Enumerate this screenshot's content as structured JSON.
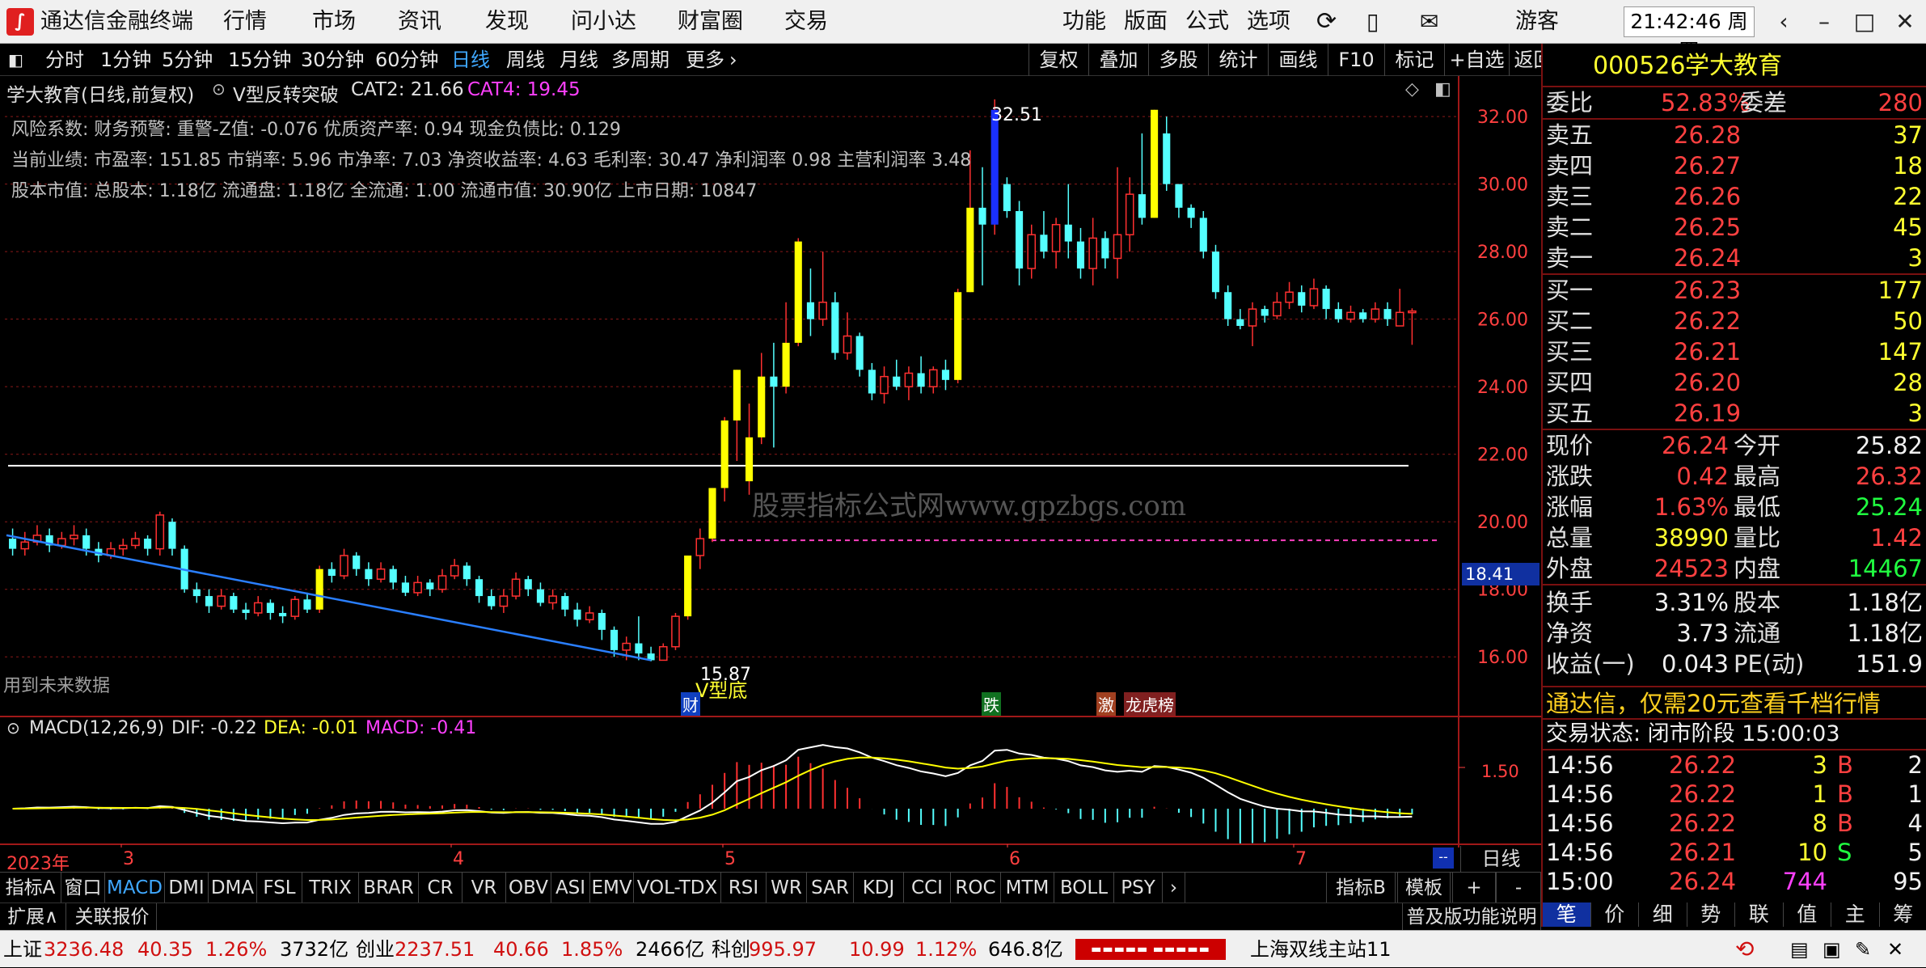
{
  "window": {
    "app_title": "通达信金融终端",
    "menus": [
      "行情",
      "市场",
      "资讯",
      "发现",
      "问小达",
      "财富圈",
      "交易"
    ],
    "tools": [
      "功能",
      "版面",
      "公式",
      "选项"
    ],
    "user": "游客",
    "clock": "21:42:46 周四"
  },
  "periods": [
    "分时",
    "1分钟",
    "5分钟",
    "15分钟",
    "30分钟",
    "60分钟",
    "日线",
    "周线",
    "月线",
    "多周期",
    "更多"
  ],
  "active_period": "日线",
  "right_buttons": [
    "复权",
    "叠加",
    "多股",
    "统计",
    "画线",
    "F10",
    "标记",
    "+自选",
    "返回"
  ],
  "chart_header": {
    "name": "学大教育(日线,前复权)",
    "indicator": "V型反转突破",
    "cat2": "CAT2: 21.66",
    "cat4": "CAT4: 19.45"
  },
  "info_lines": [
    "风险系数: 财务预警: 重警-Z值: -0.076 优质资产率: 0.94 现金负债比: 0.129",
    "当前业绩: 市盈率: 151.85 市销率: 5.96 市净率: 7.03 净资收益率: 4.63 毛利率: 30.47 净利润率 0.98 主营利润率 3.48",
    "股本市值: 总股本: 1.18亿 流通盘: 1.18亿 全流通: 1.00 流通市值: 30.90亿 上市日期: 10847"
  ],
  "annotations": {
    "future_data": "用到未来数据",
    "high_label": "32.51",
    "low_label": "15.87",
    "v_bottom": "V型底",
    "watermark": "股票指标公式网www.gpzbgs.com",
    "marks": [
      "财",
      "跌",
      "激",
      "龙虎榜"
    ],
    "price_tag": "18.41"
  },
  "macd_header": {
    "name": "MACD(12,26,9)",
    "dif": "DIF: -0.22",
    "dea": "DEA: -0.01",
    "macd": "MACD: -0.41",
    "axis_label": "1.50"
  },
  "x_axis": {
    "year": "2023年",
    "months": [
      "3",
      "4",
      "5",
      "6",
      "7"
    ],
    "period": "日线"
  },
  "colors": {
    "up": "#ff3030",
    "down": "#54ffff",
    "macd_dif": "#ffffff",
    "macd_dea": "#ffff00",
    "trend": "#2a7fff"
  },
  "chart_data": {
    "type": "candlestick",
    "y_axis": {
      "ticks": [
        16.0,
        18.0,
        20.0,
        22.0,
        24.0,
        26.0,
        28.0,
        30.0,
        32.0
      ],
      "ylim": [
        15.0,
        33.2
      ]
    },
    "hline": 21.66,
    "dash_line": 19.45,
    "trendline": [
      [
        19.6,
        15.9
      ]
    ],
    "candles": [
      [
        19.5,
        19.2,
        19.8,
        19.0
      ],
      [
        19.2,
        19.4,
        19.7,
        19.0
      ],
      [
        19.4,
        19.6,
        19.9,
        19.3
      ],
      [
        19.6,
        19.3,
        19.8,
        19.1
      ],
      [
        19.3,
        19.5,
        19.7,
        19.2
      ],
      [
        19.5,
        19.6,
        19.9,
        19.3
      ],
      [
        19.6,
        19.2,
        19.8,
        19.0
      ],
      [
        19.2,
        19.0,
        19.4,
        18.8
      ],
      [
        19.0,
        19.2,
        19.4,
        18.9
      ],
      [
        19.2,
        19.3,
        19.5,
        19.0
      ],
      [
        19.3,
        19.5,
        19.7,
        19.2
      ],
      [
        19.5,
        19.2,
        19.6,
        19.0
      ],
      [
        19.2,
        20.2,
        20.3,
        19.0
      ],
      [
        20.0,
        19.2,
        20.1,
        19.0
      ],
      [
        19.2,
        18.0,
        19.3,
        17.9
      ],
      [
        18.0,
        17.8,
        18.2,
        17.6
      ],
      [
        17.8,
        17.5,
        18.0,
        17.3
      ],
      [
        17.5,
        17.8,
        18.0,
        17.4
      ],
      [
        17.8,
        17.4,
        17.9,
        17.3
      ],
      [
        17.4,
        17.3,
        17.6,
        17.1
      ],
      [
        17.3,
        17.6,
        17.8,
        17.2
      ],
      [
        17.6,
        17.3,
        17.7,
        17.1
      ],
      [
        17.3,
        17.2,
        17.5,
        17.0
      ],
      [
        17.2,
        17.7,
        17.8,
        17.1
      ],
      [
        17.7,
        17.4,
        17.9,
        17.3
      ],
      [
        17.4,
        18.6,
        18.7,
        17.3
      ],
      [
        18.6,
        18.4,
        18.8,
        18.2
      ],
      [
        18.4,
        19.0,
        19.2,
        18.3
      ],
      [
        19.0,
        18.6,
        19.1,
        18.4
      ],
      [
        18.6,
        18.3,
        18.8,
        18.1
      ],
      [
        18.3,
        18.6,
        18.8,
        18.2
      ],
      [
        18.6,
        18.2,
        18.7,
        18.0
      ],
      [
        18.2,
        17.9,
        18.4,
        17.8
      ],
      [
        17.9,
        18.2,
        18.4,
        17.8
      ],
      [
        18.2,
        18.0,
        18.3,
        17.8
      ],
      [
        18.0,
        18.4,
        18.6,
        17.9
      ],
      [
        18.4,
        18.7,
        18.9,
        18.3
      ],
      [
        18.7,
        18.3,
        18.8,
        18.1
      ],
      [
        18.3,
        17.8,
        18.4,
        17.6
      ],
      [
        17.8,
        17.5,
        18.0,
        17.4
      ],
      [
        17.5,
        17.8,
        18.0,
        17.3
      ],
      [
        17.8,
        18.3,
        18.5,
        17.7
      ],
      [
        18.3,
        18.0,
        18.4,
        17.8
      ],
      [
        18.0,
        17.6,
        18.2,
        17.5
      ],
      [
        17.6,
        17.8,
        18.0,
        17.4
      ],
      [
        17.8,
        17.4,
        17.9,
        17.2
      ],
      [
        17.4,
        17.1,
        17.6,
        16.9
      ],
      [
        17.1,
        17.3,
        17.5,
        17.0
      ],
      [
        17.3,
        16.8,
        17.4,
        16.5
      ],
      [
        16.8,
        16.2,
        16.9,
        16.0
      ],
      [
        16.2,
        16.4,
        16.6,
        15.9
      ],
      [
        16.4,
        16.1,
        17.2,
        15.9
      ],
      [
        16.1,
        15.9,
        16.3,
        15.87
      ],
      [
        15.9,
        16.3,
        16.4,
        15.9
      ],
      [
        16.3,
        17.2,
        17.3,
        16.2
      ],
      [
        17.2,
        19.0,
        19.0,
        17.1
      ],
      [
        19.0,
        19.5,
        19.8,
        18.6
      ],
      [
        19.5,
        21.0,
        21.0,
        19.4
      ],
      [
        21.0,
        23.0,
        23.1,
        20.6
      ],
      [
        23.0,
        24.5,
        24.5,
        21.8
      ],
      [
        21.2,
        22.5,
        23.5,
        20.8
      ],
      [
        22.5,
        24.3,
        25.0,
        22.3
      ],
      [
        24.3,
        24.0,
        25.3,
        22.2
      ],
      [
        24.0,
        25.3,
        26.5,
        23.8
      ],
      [
        25.3,
        28.3,
        28.4,
        25.2
      ],
      [
        26.5,
        26.0,
        27.5,
        25.5
      ],
      [
        26.0,
        26.5,
        28.0,
        25.8
      ],
      [
        26.5,
        25.0,
        26.8,
        24.8
      ],
      [
        25.0,
        25.5,
        26.2,
        24.8
      ],
      [
        25.5,
        24.5,
        25.6,
        24.3
      ],
      [
        24.5,
        23.8,
        24.7,
        23.6
      ],
      [
        23.8,
        24.3,
        24.6,
        23.5
      ],
      [
        24.3,
        24.0,
        24.8,
        23.9
      ],
      [
        24.0,
        24.4,
        24.6,
        23.6
      ],
      [
        24.4,
        24.0,
        24.9,
        23.8
      ],
      [
        24.0,
        24.5,
        24.6,
        23.8
      ],
      [
        24.5,
        24.2,
        24.8,
        23.9
      ],
      [
        24.2,
        26.8,
        26.9,
        24.1
      ],
      [
        26.8,
        29.3,
        31.0,
        26.8
      ],
      [
        29.3,
        28.8,
        30.5,
        27.0
      ],
      [
        28.8,
        32.2,
        32.51,
        28.5
      ],
      [
        30.0,
        29.2,
        30.2,
        29.0
      ],
      [
        29.2,
        27.5,
        29.5,
        27.0
      ],
      [
        27.5,
        28.5,
        28.8,
        27.2
      ],
      [
        28.5,
        28.0,
        29.2,
        27.8
      ],
      [
        28.0,
        28.8,
        29.0,
        27.5
      ],
      [
        28.8,
        28.3,
        30.0,
        27.8
      ],
      [
        28.3,
        27.5,
        28.7,
        27.2
      ],
      [
        27.5,
        28.4,
        29.0,
        27.0
      ],
      [
        28.4,
        27.8,
        28.6,
        27.5
      ],
      [
        27.8,
        28.5,
        30.5,
        27.2
      ],
      [
        28.5,
        29.7,
        30.2,
        28.0
      ],
      [
        29.7,
        29.0,
        31.5,
        28.8
      ],
      [
        29.0,
        32.2,
        32.2,
        29.0
      ],
      [
        31.5,
        30.0,
        32.0,
        29.8
      ],
      [
        30.0,
        29.3,
        29.6,
        29.0
      ],
      [
        29.3,
        29.0,
        29.4,
        28.7
      ],
      [
        29.0,
        28.0,
        29.2,
        27.8
      ],
      [
        28.0,
        26.8,
        28.2,
        26.6
      ],
      [
        26.8,
        26.0,
        27.0,
        25.8
      ],
      [
        26.0,
        25.8,
        26.3,
        25.7
      ],
      [
        25.8,
        26.3,
        26.5,
        25.2
      ],
      [
        26.3,
        26.1,
        26.4,
        25.9
      ],
      [
        26.1,
        26.5,
        26.8,
        26.0
      ],
      [
        26.5,
        26.8,
        27.1,
        26.3
      ],
      [
        26.8,
        26.4,
        27.0,
        26.2
      ],
      [
        26.4,
        26.9,
        27.2,
        26.3
      ],
      [
        26.9,
        26.3,
        27.0,
        26.0
      ],
      [
        26.3,
        26.0,
        26.5,
        25.9
      ],
      [
        26.0,
        26.2,
        26.4,
        25.9
      ],
      [
        26.2,
        26.0,
        26.3,
        25.9
      ],
      [
        26.0,
        26.3,
        26.5,
        25.9
      ],
      [
        26.3,
        26.0,
        26.5,
        25.8
      ],
      [
        25.8,
        26.2,
        26.9,
        25.8
      ],
      [
        26.2,
        26.24,
        26.32,
        25.24
      ]
    ]
  },
  "right_panel": {
    "stock_code": "000526",
    "stock_name": "学大教育",
    "webi_label": "委比",
    "webi": "52.83%",
    "weicha_label": "委差",
    "weicha": "280",
    "asks": [
      {
        "label": "卖五",
        "price": "26.28",
        "vol": "37"
      },
      {
        "label": "卖四",
        "price": "26.27",
        "vol": "18"
      },
      {
        "label": "卖三",
        "price": "26.26",
        "vol": "22"
      },
      {
        "label": "卖二",
        "price": "26.25",
        "vol": "45"
      },
      {
        "label": "卖一",
        "price": "26.24",
        "vol": "3"
      }
    ],
    "bids": [
      {
        "label": "买一",
        "price": "26.23",
        "vol": "177"
      },
      {
        "label": "买二",
        "price": "26.22",
        "vol": "50"
      },
      {
        "label": "买三",
        "price": "26.21",
        "vol": "147"
      },
      {
        "label": "买四",
        "price": "26.20",
        "vol": "28"
      },
      {
        "label": "买五",
        "price": "26.19",
        "vol": "3"
      }
    ],
    "quote": [
      {
        "l1": "现价",
        "v1": "26.24",
        "c1": "red",
        "l2": "今开",
        "v2": "25.82",
        "c2": "white"
      },
      {
        "l1": "涨跌",
        "v1": "0.42",
        "c1": "red",
        "l2": "最高",
        "v2": "26.32",
        "c2": "red"
      },
      {
        "l1": "涨幅",
        "v1": "1.63%",
        "c1": "red",
        "l2": "最低",
        "v2": "25.24",
        "c2": "green"
      },
      {
        "l1": "总量",
        "v1": "38990",
        "c1": "yellow",
        "l2": "量比",
        "v2": "1.42",
        "c2": "red"
      },
      {
        "l1": "外盘",
        "v1": "24523",
        "c1": "red",
        "l2": "内盘",
        "v2": "14467",
        "c2": "green"
      }
    ],
    "fund": [
      {
        "l1": "换手",
        "v1": "3.31%",
        "l2": "股本",
        "v2": "1.18亿"
      },
      {
        "l1": "净资",
        "v1": "3.73",
        "l2": "流通",
        "v2": "1.18亿"
      },
      {
        "l1": "收益(一)",
        "v1": "0.043",
        "l2": "PE(动)",
        "v2": "151.9"
      }
    ],
    "promo": "通达信，仅需20元查看千档行情",
    "trade_state": "交易状态: 闭市阶段 15:00:03",
    "ticks": [
      {
        "time": "14:56",
        "price": "26.22",
        "vol": "3",
        "side": "B",
        "n": "2"
      },
      {
        "time": "14:56",
        "price": "26.22",
        "vol": "1",
        "side": "B",
        "n": "1"
      },
      {
        "time": "14:56",
        "price": "26.22",
        "vol": "8",
        "side": "B",
        "n": "4"
      },
      {
        "time": "14:56",
        "price": "26.21",
        "vol": "10",
        "side": "S",
        "n": "5"
      },
      {
        "time": "15:00",
        "price": "26.24",
        "vol": "744",
        "side": "",
        "n": "95"
      }
    ],
    "bottom_tabs": [
      "笔",
      "价",
      "细",
      "势",
      "联",
      "值",
      "主",
      "筹"
    ]
  },
  "indicator_tabs": [
    "指标A",
    "窗口",
    "MACD",
    "DMI",
    "DMA",
    "FSL",
    "TRIX",
    "BRAR",
    "CR",
    "VR",
    "OBV",
    "ASI",
    "EMV",
    "VOL-TDX",
    "RSI",
    "WR",
    "SAR",
    "KDJ",
    "CCI",
    "ROC",
    "MTM",
    "BOLL",
    "PSY"
  ],
  "indicator_tabs_right": [
    "指标B",
    "模板",
    "+",
    "-"
  ],
  "expand_bar": {
    "expand": "扩展∧",
    "related": "关联报价",
    "help": "普及版功能说明"
  },
  "status_bar": {
    "sh_label": "上证",
    "sh_val": "3236.48",
    "sh_chg": "40.35",
    "sh_pct": "1.26%",
    "sh_amt": "3732亿",
    "cy_label": "创业",
    "cy_val": "2237.51",
    "cy_chg": "40.66",
    "cy_pct": "1.85%",
    "cy_amt": "2466亿",
    "kc_label": "科创",
    "kc_val": "995.97",
    "kc_chg": "10.99",
    "kc_pct": "1.12%",
    "kc_amt": "646.8亿",
    "server": "上海双线主站11"
  }
}
